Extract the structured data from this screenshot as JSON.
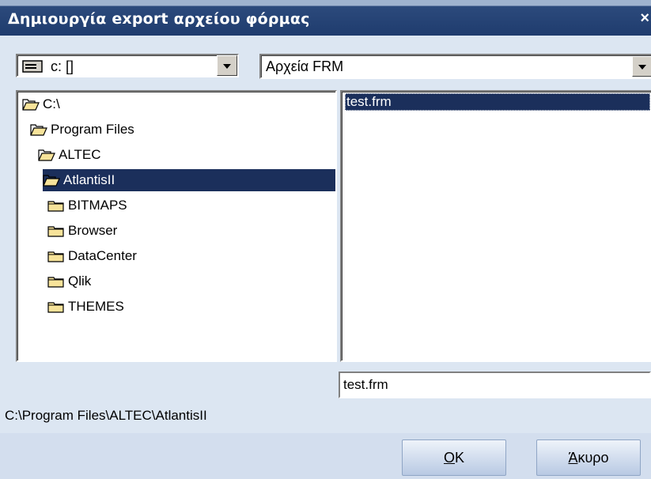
{
  "window": {
    "title": "Δημιουργία export αρχείου φόρμας",
    "close": "×"
  },
  "drive": {
    "value": "c: []",
    "icon": "drive-icon"
  },
  "filetype": {
    "value": "Αρχεία FRM"
  },
  "tree": [
    {
      "label": "C:\\",
      "icon": "open-folder-icon",
      "selected": false
    },
    {
      "label": "Program Files",
      "icon": "open-folder-icon",
      "selected": false
    },
    {
      "label": "ALTEC",
      "icon": "open-folder-icon",
      "selected": false
    },
    {
      "label": "AtlantisII",
      "icon": "open-folder-icon",
      "selected": true
    },
    {
      "label": "BITMAPS",
      "icon": "folder-icon",
      "selected": false
    },
    {
      "label": "Browser",
      "icon": "folder-icon",
      "selected": false
    },
    {
      "label": "DataCenter",
      "icon": "folder-icon",
      "selected": false
    },
    {
      "label": "Qlik",
      "icon": "folder-icon",
      "selected": false
    },
    {
      "label": "THEMES",
      "icon": "folder-icon",
      "selected": false
    }
  ],
  "files": [
    "test.frm"
  ],
  "filename": {
    "value": "test.frm"
  },
  "current_path": "C:\\Program Files\\ALTEC\\AtlantisII",
  "buttons": {
    "ok_mnemonic": "O",
    "ok_rest": "K",
    "cancel_mnemonic": "Ά",
    "cancel_rest": "κυρο"
  },
  "colors": {
    "titlebar": "#1f3c6e",
    "selection": "#1b2f5b",
    "dialog_bg": "#dce6f2"
  }
}
